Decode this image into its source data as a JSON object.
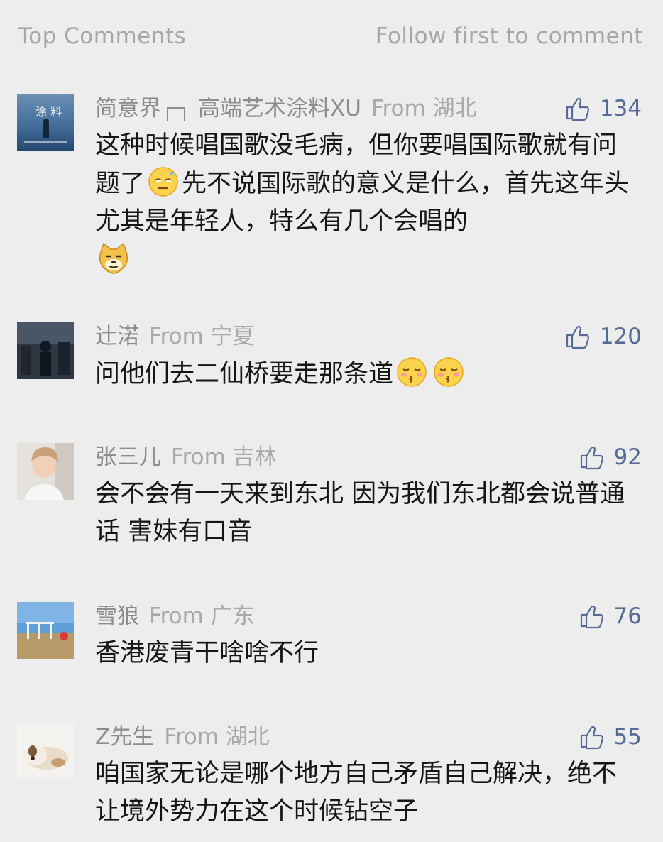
{
  "header": {
    "title": "Top Comments",
    "action": "Follow first to comment"
  },
  "colors": {
    "background": "#ededed",
    "link_blue": "#576b95",
    "meta_gray": "#a7a7a7",
    "text": "#151515"
  },
  "comments": [
    {
      "name": "简意界",
      "extra": "高端艺术涂料XU",
      "from": "From 湖北",
      "likes": "134",
      "text_part1": "这种时候唱国歌没毛病，但你要唱国际歌就有问题了",
      "text_part2": "先不说国际歌的意义是什么，首先这年头尤其是年轻人，特么有几个会唱的",
      "emoji_a": "sweat-face-emoji",
      "emoji_b": "doge-emoji"
    },
    {
      "name": "辻渃",
      "from": "From 宁夏",
      "likes": "120",
      "text": "问他们去二仙桥要走那条道",
      "emoji": "kissing-face-emoji"
    },
    {
      "name": "张三儿",
      "from": "From 吉林",
      "likes": "92",
      "text": "会不会有一天来到东北 因为我们东北都会说普通话 害妹有口音"
    },
    {
      "name": "雪狼",
      "from": "From 广东",
      "likes": "76",
      "text": "香港废青干啥啥不行"
    },
    {
      "name": "Z先生",
      "from": "From 湖北",
      "likes": "55",
      "text": "咱国家无论是哪个地方自己矛盾自己解决，绝不让境外势力在这个时候钻空子"
    }
  ],
  "icons": {
    "like": "thumbs-up-icon"
  }
}
